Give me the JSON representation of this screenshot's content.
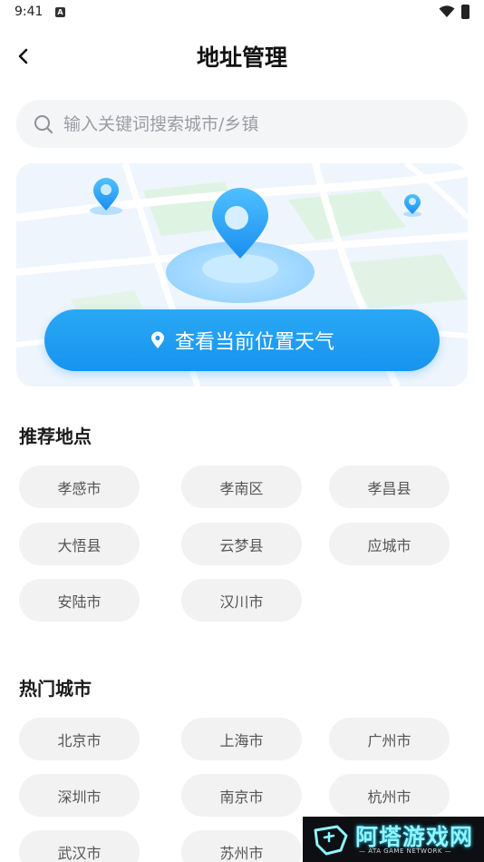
{
  "status_bar": {
    "time": "9:41",
    "notification_letter": "A"
  },
  "header": {
    "title": "地址管理"
  },
  "search": {
    "placeholder": "输入关键词搜索城市/乡镇",
    "value": ""
  },
  "map_card": {
    "locate_label": "查看当前位置天气"
  },
  "recommended": {
    "title": "推荐地点",
    "items": [
      "孝感市",
      "孝南区",
      "孝昌县",
      "大悟县",
      "云梦县",
      "应城市",
      "安陆市",
      "汉川市"
    ]
  },
  "hot_cities": {
    "title": "热门城市",
    "items": [
      "北京市",
      "上海市",
      "广州市",
      "深圳市",
      "南京市",
      "杭州市",
      "武汉市",
      "苏州市"
    ]
  },
  "watermark": {
    "name": "阿塔游戏网",
    "subtitle": "— ATA GAME NETWORK —"
  },
  "colors": {
    "accent": "#1d9bf0",
    "chip_bg": "#f2f2f3",
    "search_bg": "#f4f5f7"
  },
  "icons": [
    "back-icon",
    "search-icon",
    "pin-icon",
    "location-marker-icon",
    "wifi-icon",
    "battery-icon"
  ]
}
